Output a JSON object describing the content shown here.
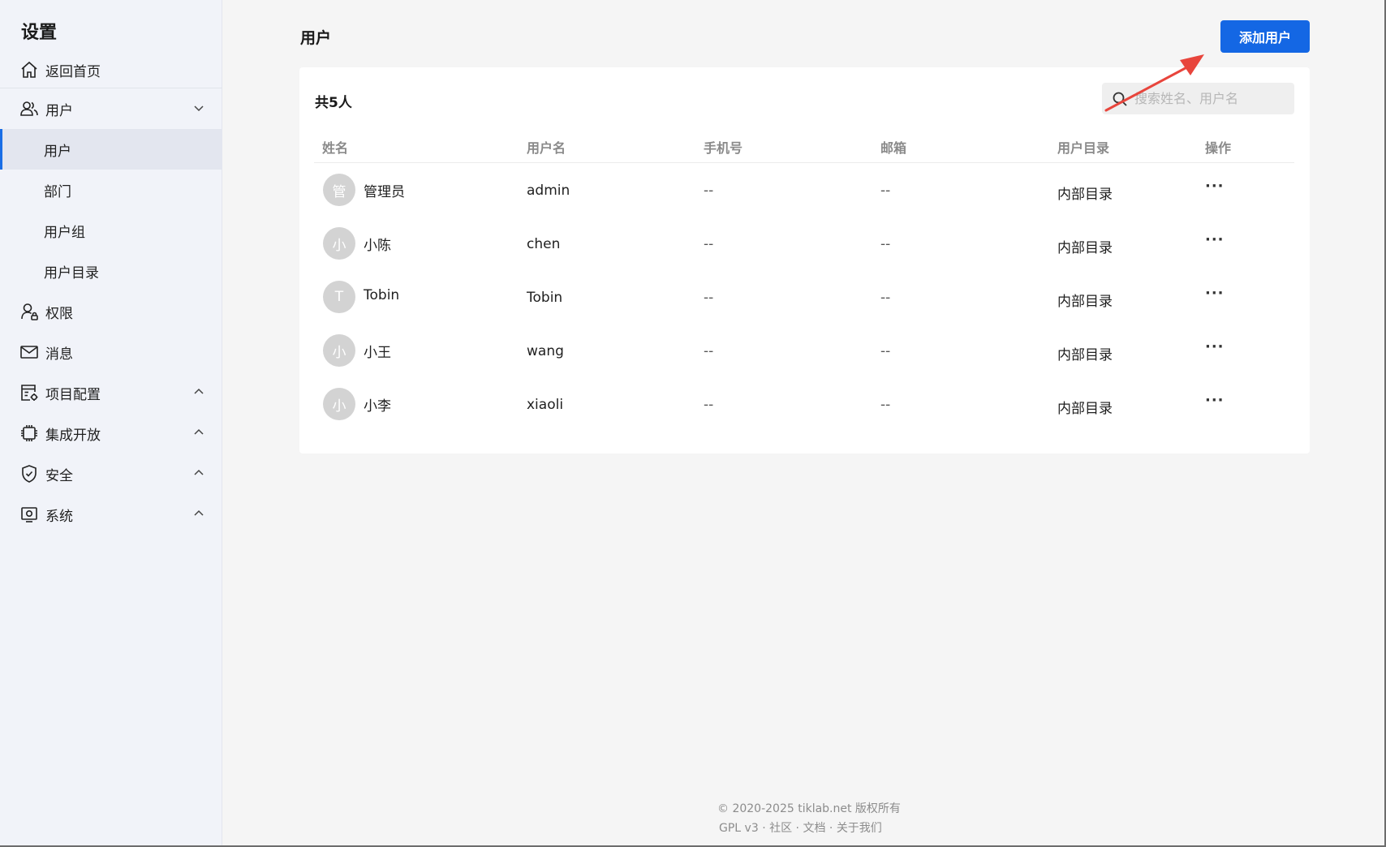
{
  "sidebar": {
    "title": "设置",
    "home": "返回首页",
    "users_group": "用户",
    "sub_items": [
      "用户",
      "部门",
      "用户组",
      "用户目录"
    ],
    "items": [
      "权限",
      "消息",
      "项目配置",
      "集成开放",
      "安全",
      "系统"
    ]
  },
  "header": {
    "title": "用户",
    "add_button": "添加用户"
  },
  "card": {
    "count": "共5人",
    "search_placeholder": "搜索姓名、用户名"
  },
  "table": {
    "columns": [
      "姓名",
      "用户名",
      "手机号",
      "邮箱",
      "用户目录",
      "操作"
    ],
    "rows": [
      {
        "avatar": "管",
        "name": "管理员",
        "username": "admin",
        "phone": "--",
        "email": "--",
        "directory": "内部目录",
        "action": "···"
      },
      {
        "avatar": "小",
        "name": "小陈",
        "username": "chen",
        "phone": "--",
        "email": "--",
        "directory": "内部目录",
        "action": "···"
      },
      {
        "avatar": "T",
        "name": "Tobin",
        "username": "Tobin",
        "phone": "--",
        "email": "--",
        "directory": "内部目录",
        "action": "···"
      },
      {
        "avatar": "小",
        "name": "小王",
        "username": "wang",
        "phone": "--",
        "email": "--",
        "directory": "内部目录",
        "action": "···"
      },
      {
        "avatar": "小",
        "name": "小李",
        "username": "xiaoli",
        "phone": "--",
        "email": "--",
        "directory": "内部目录",
        "action": "···"
      }
    ]
  },
  "footer": {
    "copyright": "© 2020-2025 tiklab.net 版权所有",
    "links": [
      "GPL v3",
      "社区",
      "文档",
      "关于我们"
    ],
    "separator": "·"
  },
  "colors": {
    "accent": "#1467e4",
    "annotation_arrow": "#e8453c"
  }
}
